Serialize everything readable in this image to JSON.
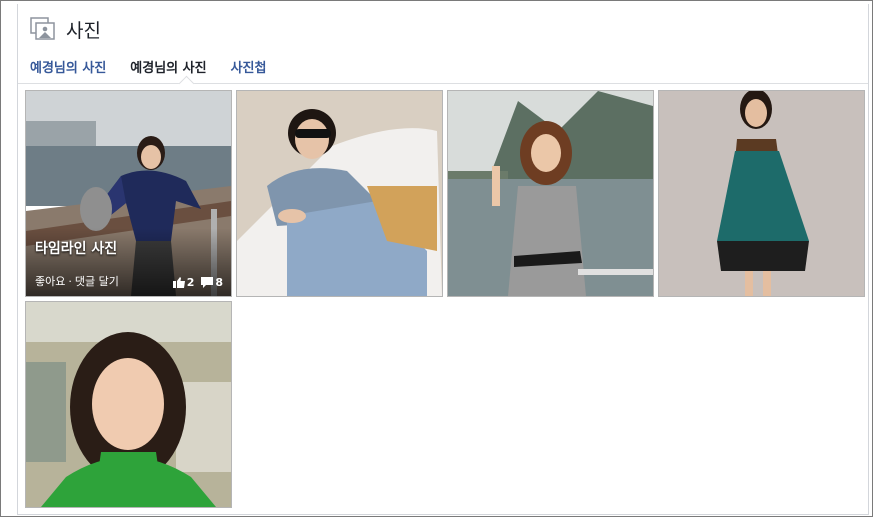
{
  "header": {
    "title": "사진",
    "icon": "photo-album-icon"
  },
  "tabs": [
    {
      "label": "예경님의 사진"
    },
    {
      "label": "예경님의 사진"
    },
    {
      "label": "사진첩"
    }
  ],
  "photos": [
    {
      "caption": "타임라인 사진",
      "like_label": "좋아요",
      "separator": "·",
      "comment_label": "댓글 달기",
      "like_count": "2",
      "comment_count": "8"
    },
    {},
    {},
    {},
    {}
  ],
  "colors": {
    "link": "#365899",
    "text": "#1d2129",
    "border": "#dddfe2"
  }
}
